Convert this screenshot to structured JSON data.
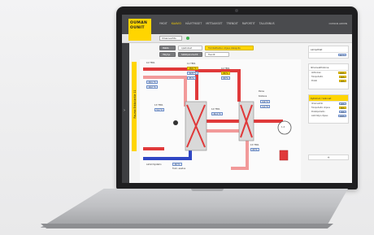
{
  "app": {
    "logo_line1": "OUMAN",
    "logo_line2": "OUNIT",
    "nav": [
      "YHDIT",
      "KAAVIO",
      "HÄLYTYKSET",
      "MITTAUKSET",
      "TRENDIT",
      "RAPORTIT",
      "TALLENNUS"
    ],
    "nav_active_index": 1,
    "user": "OUMAN ADMIN",
    "selector_value": "Ilmanvaihto",
    "status_led_color": "#3fb34f",
    "location_label": "Rauma Erkkolantie 11"
  },
  "toolbar": {
    "row1": [
      "Päällä",
      "Ajastukset",
      "Toimilaitteiden ohjaus käsiajolla"
    ],
    "row2": [
      "Hälytys",
      "Säätöparametrit",
      "Trendit"
    ]
  },
  "diagram": {
    "labels": {
      "outdoor": "10 TE01",
      "supply_fan": "11 TE01",
      "heat_rec": "13 TE01",
      "after_hr": "14 TE01",
      "exhaust": "15 TE01",
      "return_fan": "12 TE01",
      "supply_pressure": "Paine",
      "rh_title": "Kosteus",
      "bottom_left": "Lämmitysteho",
      "setpoint_label": "Tulol. asetus"
    },
    "values": {
      "v1": "18,6 °C",
      "v2": "22,8 °C",
      "v3": "35 %",
      "v4": "20,1 °C",
      "v5": "19,2 °C",
      "v6": "5,1 °C",
      "v7": "21,4 °C",
      "v8": "80 %",
      "v9": "60 %",
      "v10": "4,9 °C",
      "v11": "1,1 °C",
      "v12": "63 %",
      "v13": "16 °C",
      "fan_speed": "1.2"
    }
  },
  "right_panel": {
    "card1_title": "Lämpötilat",
    "card1_value": "20 °C",
    "card2_title": "Ilmanvaihtokone",
    "card2_rows": [
      {
        "label": "Aktiivinen",
        "value": "100%"
      },
      {
        "label": "Tulopuhallin",
        "value": "60%"
      },
      {
        "label": "Poisto",
        "value": "40%"
      }
    ],
    "card3_title": "Kytkimet / Valinnat",
    "card3_rows": [
      {
        "label": "Ilmanvaihto",
        "value": "20%"
      },
      {
        "label": "Tulopuhallin ohjaus",
        "value": "80%"
      },
      {
        "label": "Poistopuhallin",
        "value": "76%"
      },
      {
        "label": "Lämmitys ohjaus",
        "value": "100%"
      }
    ],
    "add_label": "+"
  },
  "colors": {
    "brand_yellow": "#ffd500",
    "supply_red": "#e0393a",
    "return_red": "#f29a9a",
    "cold_blue": "#2f46c4",
    "header_dark": "#4a4b4e"
  }
}
